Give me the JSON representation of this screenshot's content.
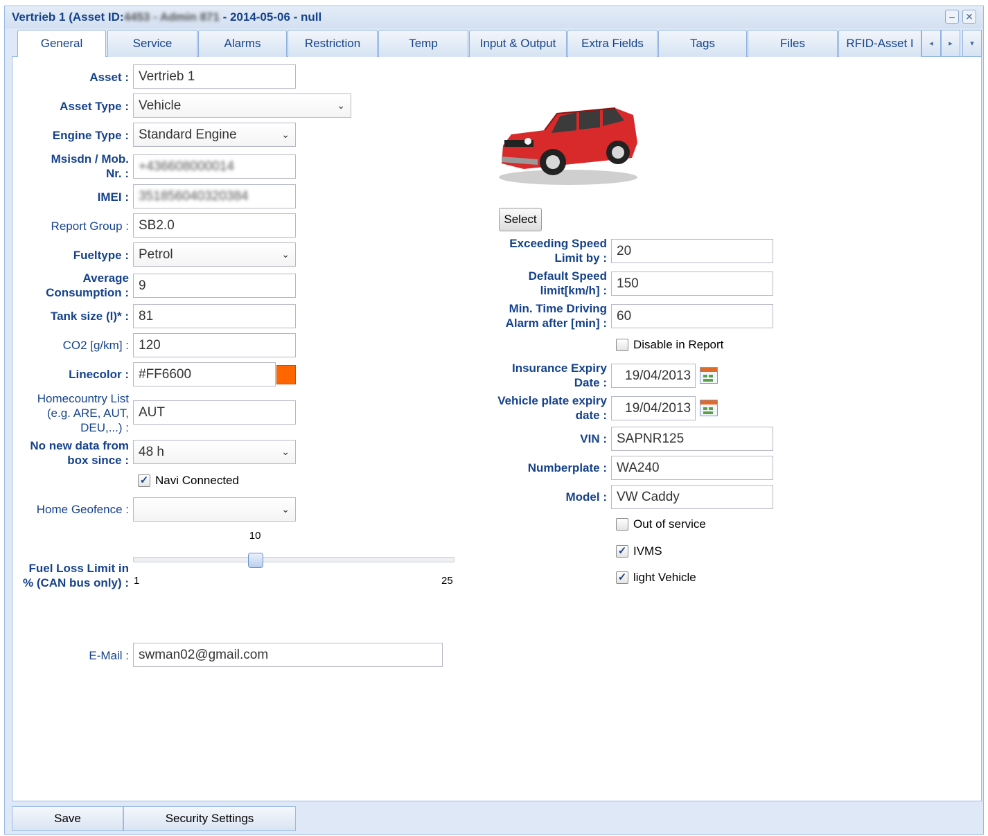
{
  "window": {
    "title_prefix": "Vertrieb 1 (Asset ID:",
    "title_redacted": "4453 - Admin 871",
    "title_suffix": " - 2014-05-06 - null",
    "minimize_glyph": "–",
    "close_glyph": "✕"
  },
  "tabs": [
    {
      "label": "General"
    },
    {
      "label": "Service"
    },
    {
      "label": "Alarms"
    },
    {
      "label": "Restriction"
    },
    {
      "label": "Temp"
    },
    {
      "label": "Input & Output"
    },
    {
      "label": "Extra Fields"
    },
    {
      "label": "Tags"
    },
    {
      "label": "Files"
    },
    {
      "label": "RFID-Asset I"
    }
  ],
  "tab_controls": {
    "left": "◂",
    "right": "▸",
    "menu": "▾"
  },
  "form_left": {
    "asset": {
      "label": "Asset :",
      "value": "Vertrieb 1"
    },
    "asset_type": {
      "label": "Asset Type :",
      "value": "Vehicle"
    },
    "engine_type": {
      "label": "Engine Type :",
      "value": "Standard Engine"
    },
    "msisdn": {
      "label": "Msisdn / Mob. Nr. :",
      "value": "+436608000014"
    },
    "imei": {
      "label": "IMEI :",
      "value": "351856040320384"
    },
    "report_group": {
      "label": "Report Group :",
      "value": "SB2.0"
    },
    "fueltype": {
      "label": "Fueltype :",
      "value": "Petrol"
    },
    "avg_consumption": {
      "label": "Average Consumption :",
      "value": "9"
    },
    "tank_size": {
      "label": "Tank size (l)* :",
      "value": "81"
    },
    "co2": {
      "label": "CO2 [g/km] :",
      "value": "120"
    },
    "linecolor": {
      "label": "Linecolor :",
      "value": "#FF6600",
      "color": "#FF6600"
    },
    "homecountry": {
      "label": "Homecountry List (e.g. ARE, AUT, DEU,...) :",
      "value": "AUT"
    },
    "no_new_data": {
      "label": "No new data from box since :",
      "value": "48 h"
    },
    "navi_connected": {
      "label": "Navi Connected",
      "checked": true
    },
    "home_geofence": {
      "label": "Home Geofence :",
      "value": ""
    },
    "fuel_loss": {
      "label": "Fuel Loss Limit in % (CAN bus only) :",
      "value": 10,
      "value_label": "10",
      "min": 1,
      "min_label": "1",
      "max": 25,
      "max_label": "25"
    },
    "email": {
      "label": "E-Mail :",
      "value": "swman02@gmail.com"
    }
  },
  "form_right": {
    "select_button": "Select",
    "exceeding_speed": {
      "label": "Exceeding Speed Limit by :",
      "value": "20"
    },
    "default_speed": {
      "label": "Default Speed limit[km/h] :",
      "value": "150"
    },
    "min_time_driving": {
      "label": "Min. Time Driving Alarm after [min] :",
      "value": "60"
    },
    "disable_in_report": {
      "label": "Disable in Report",
      "checked": false
    },
    "insurance_expiry": {
      "label": "Insurance Expiry Date :",
      "value": "19/04/2013"
    },
    "plate_expiry": {
      "label": "Vehicle plate expiry date :",
      "value": "19/04/2013"
    },
    "vin": {
      "label": "VIN :",
      "value": "SAPNR125"
    },
    "numberplate": {
      "label": "Numberplate :",
      "value": "WA240"
    },
    "model": {
      "label": "Model :",
      "value": "VW Caddy"
    },
    "out_of_service": {
      "label": "Out of service",
      "checked": false
    },
    "ivms": {
      "label": "IVMS",
      "checked": true
    },
    "light_vehicle": {
      "label": "light Vehicle",
      "checked": true
    }
  },
  "footer": {
    "save": "Save",
    "security_settings": "Security Settings"
  },
  "glyphs": {
    "check": "✓",
    "chevron": "⌄"
  },
  "colors": {
    "accent": "#15428b",
    "border": "#99bbe8",
    "car": "#d82a2a"
  }
}
